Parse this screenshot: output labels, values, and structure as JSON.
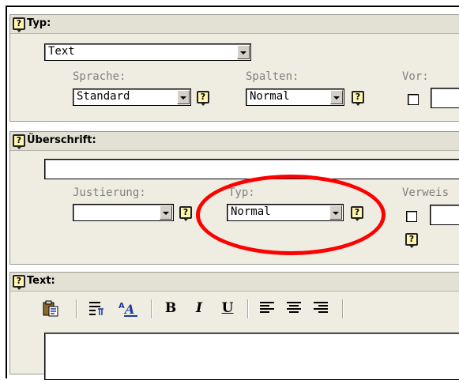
{
  "section_typ": {
    "label": "Typ:",
    "typ_value": "Text",
    "sprache_label": "Sprache:",
    "sprache_value": "Standard",
    "spalten_label": "Spalten:",
    "spalten_value": "Normal",
    "vor_label": "Vor:"
  },
  "section_ueberschrift": {
    "label": "Überschrift:",
    "title_value": "",
    "justierung_label": "Justierung:",
    "justierung_value": "",
    "typ_label": "Typ:",
    "typ_value": "Normal",
    "verweis_label": "Verweis"
  },
  "section_text": {
    "label": "Text:",
    "toolbar": {
      "bold": "B",
      "italic": "I",
      "underline": "U",
      "font_size_glyph": "A"
    }
  },
  "help_glyph": "?",
  "icons": [
    "help-icon",
    "paste-icon",
    "paragraph-format-icon",
    "font-size-icon",
    "align-left-icon",
    "align-center-icon",
    "align-right-icon",
    "dropdown-arrow-icon"
  ],
  "highlight_color": "#ff0000"
}
